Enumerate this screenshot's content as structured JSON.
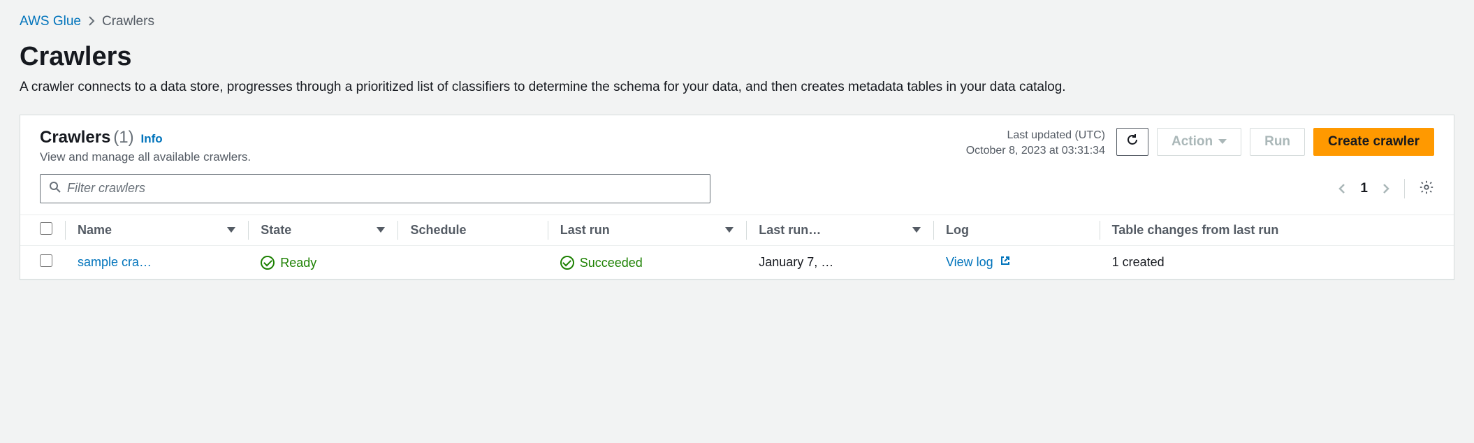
{
  "breadcrumb": {
    "root": "AWS Glue",
    "current": "Crawlers"
  },
  "page": {
    "title": "Crawlers",
    "description": "A crawler connects to a data store, progresses through a prioritized list of classifiers to determine the schema for your data, and then creates metadata tables in your data catalog."
  },
  "panel": {
    "title": "Crawlers",
    "count": "(1)",
    "info_label": "Info",
    "subtitle": "View and manage all available crawlers.",
    "last_updated_label": "Last updated (UTC)",
    "last_updated_value": "October 8, 2023 at 03:31:34",
    "buttons": {
      "action": "Action",
      "run": "Run",
      "create": "Create crawler"
    }
  },
  "filter": {
    "placeholder": "Filter crawlers"
  },
  "pagination": {
    "page": "1"
  },
  "table": {
    "headers": {
      "name": "Name",
      "state": "State",
      "schedule": "Schedule",
      "last_run": "Last run",
      "last_run_2": "Last run…",
      "log": "Log",
      "table_changes": "Table changes from last run"
    },
    "rows": [
      {
        "name": "sample cra…",
        "state": "Ready",
        "schedule": "",
        "last_run": "Succeeded",
        "last_run_date": "January 7, …",
        "log": "View log",
        "table_changes": "1 created"
      }
    ]
  }
}
